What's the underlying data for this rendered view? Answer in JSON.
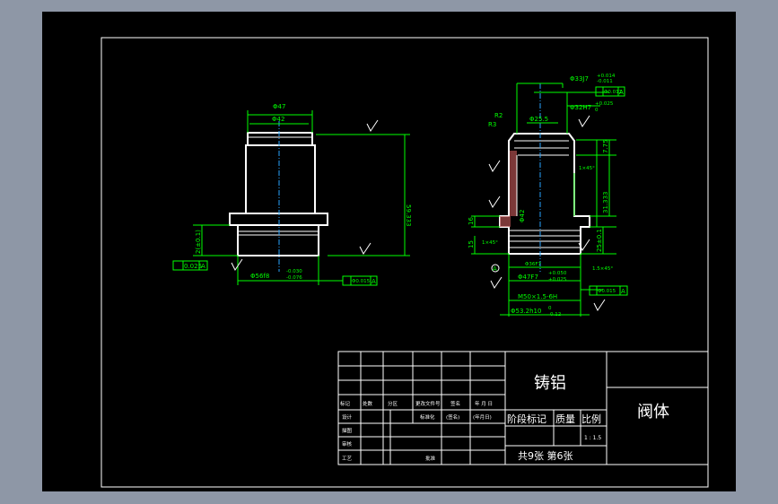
{
  "title_block": {
    "material": "铸铝",
    "part_name": "阀体",
    "stage_mark": "阶段标记",
    "weight": "质量",
    "scale_label": "比例",
    "scale_value": "1 : 1.5",
    "sheets": "共9张 第6张",
    "rows": {
      "mark": "标记",
      "count": "处数",
      "zone": "分区",
      "change_doc": "更改文件号",
      "sign": "签名",
      "date": "年 月 日",
      "design": "设计",
      "standardize": "标准化",
      "sign2": "(签名)",
      "date2": "(年月日)",
      "drawing": "描图",
      "review": "审核",
      "process": "工艺",
      "approve": "批准"
    }
  },
  "left_view": {
    "dim_outer": "Φ47",
    "dim_inner": "Φ42",
    "dim_height": "59.333",
    "dim_flange": "2(±0.1)",
    "dim_bore": "Φ56f8",
    "dim_bore_tol_upper": "-0.030",
    "dim_bore_tol_lower": "-0.076",
    "runout": "0.025",
    "datum": "A",
    "position_tol": "Φ0.015",
    "datum_ref": "A"
  },
  "right_view": {
    "dim_top": "Φ33J7",
    "dim_top_tol_upper": "+0.014",
    "dim_top_tol_lower": "-0.011",
    "dim_top_geo": "Φ0.012",
    "dim_bore2": "Φ32H7",
    "dim_bore2_tol_upper": "+0.025",
    "dim_bore2_tol_lower": "0",
    "dim_inner": "Φ25.5",
    "radius1": "R2",
    "radius2": "R3",
    "chamfer1": "1×45°",
    "chamfer2": "1.5×45°",
    "chamfer3": "1×45°",
    "dim_36": "Φ36F7",
    "dim_47": "Φ47F7",
    "dim_47_tol_upper": "+0.050",
    "dim_47_tol_lower": "+0.025",
    "thread": "M50×1.5-6H",
    "dim_53": "Φ53.2h10",
    "dim_53_tol_upper": "0",
    "dim_53_tol_lower": "-0.12",
    "position_tol": "Φ0.015",
    "datum": "A",
    "dim_7": "7.75",
    "dim_31": "31.333",
    "dim_25": "25±0.1",
    "dim_16": "16",
    "dim_15": "15",
    "dim_42": "Φ42"
  }
}
